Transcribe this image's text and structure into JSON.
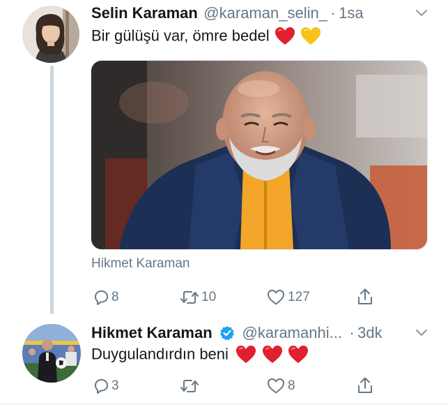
{
  "tweet1": {
    "author_name": "Selin Karaman",
    "handle": "@karaman_selin_",
    "separator": "·",
    "time": "1sa",
    "text": "Bir gülüşü var, ömre bedel",
    "media_caption": "Hikmet Karaman",
    "replies": "8",
    "retweets": "10",
    "likes": "127"
  },
  "tweet2": {
    "author_name": "Hikmet Karaman",
    "handle": "@karamanhi...",
    "separator": "·",
    "time": "3dk",
    "text": "Duygulandırdın beni",
    "replies": "3",
    "retweets": "",
    "likes": "8"
  },
  "icons": {
    "menu": "chevron-down-icon",
    "reply": "reply-icon",
    "retweet": "retweet-icon",
    "like": "heart-outline-icon",
    "share": "share-icon",
    "verified": "verified-badge-icon",
    "emoji_red": "red-heart-icon",
    "emoji_yellow": "yellow-heart-icon"
  },
  "colors": {
    "name": "#14171a",
    "secondary": "#657786",
    "verified": "#1da1f2",
    "thread_line": "#ccd6dd",
    "heart_red": "#e0202e",
    "heart_yellow": "#f7c21a"
  }
}
